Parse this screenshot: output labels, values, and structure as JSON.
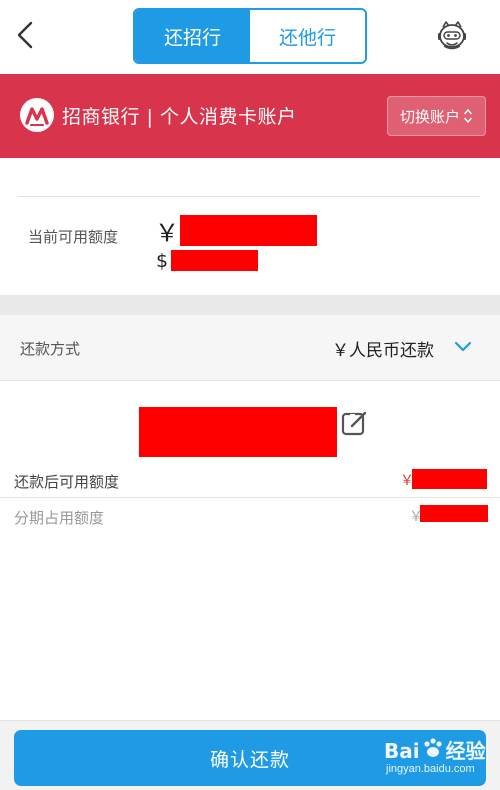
{
  "nav": {
    "tabs": [
      {
        "label": "还招行",
        "active": true
      },
      {
        "label": "还他行",
        "active": false
      }
    ],
    "back_icon": "chevron-left-icon",
    "assistant_icon": "robot-assistant-icon"
  },
  "bank": {
    "title": "招商银行 | 个人消费卡账户",
    "switch_label": "切换账户",
    "logo_icon": "cmb-logo-icon",
    "color": "#d8344c"
  },
  "credit": {
    "label": "当前可用额度",
    "cny_symbol": "￥",
    "usd_symbol": "$"
  },
  "repay": {
    "method_label": "还款方式",
    "method_value": "￥人民币还款",
    "after_label": "还款后可用额度",
    "after_symbol": "￥",
    "installment_label": "分期占用额度",
    "installment_symbol": "￥"
  },
  "footer": {
    "confirm_label": "确认还款"
  },
  "watermark": {
    "line1_a": "Bai",
    "line1_b": "经验",
    "line2": "jingyan.baidu.com"
  },
  "colors": {
    "accent": "#1f9be6",
    "brand": "#d8344c",
    "redaction": "#ff0000"
  }
}
